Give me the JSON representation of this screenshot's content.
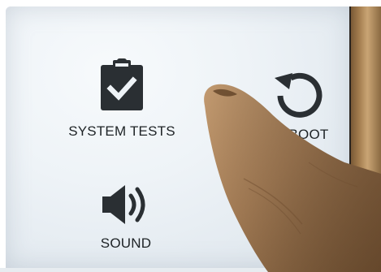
{
  "screen": {
    "tiles": [
      {
        "label": "SYSTEM TESTS",
        "icon": "clipboard-check-icon"
      },
      {
        "label": "REBOOT",
        "icon": "reboot-icon"
      },
      {
        "label": "SOUND",
        "icon": "speaker-volume-icon"
      }
    ]
  },
  "colors": {
    "icon": "#2a2f33",
    "text": "#1e2326",
    "screen_background": "#eef3f7",
    "skin": "#a98058"
  }
}
